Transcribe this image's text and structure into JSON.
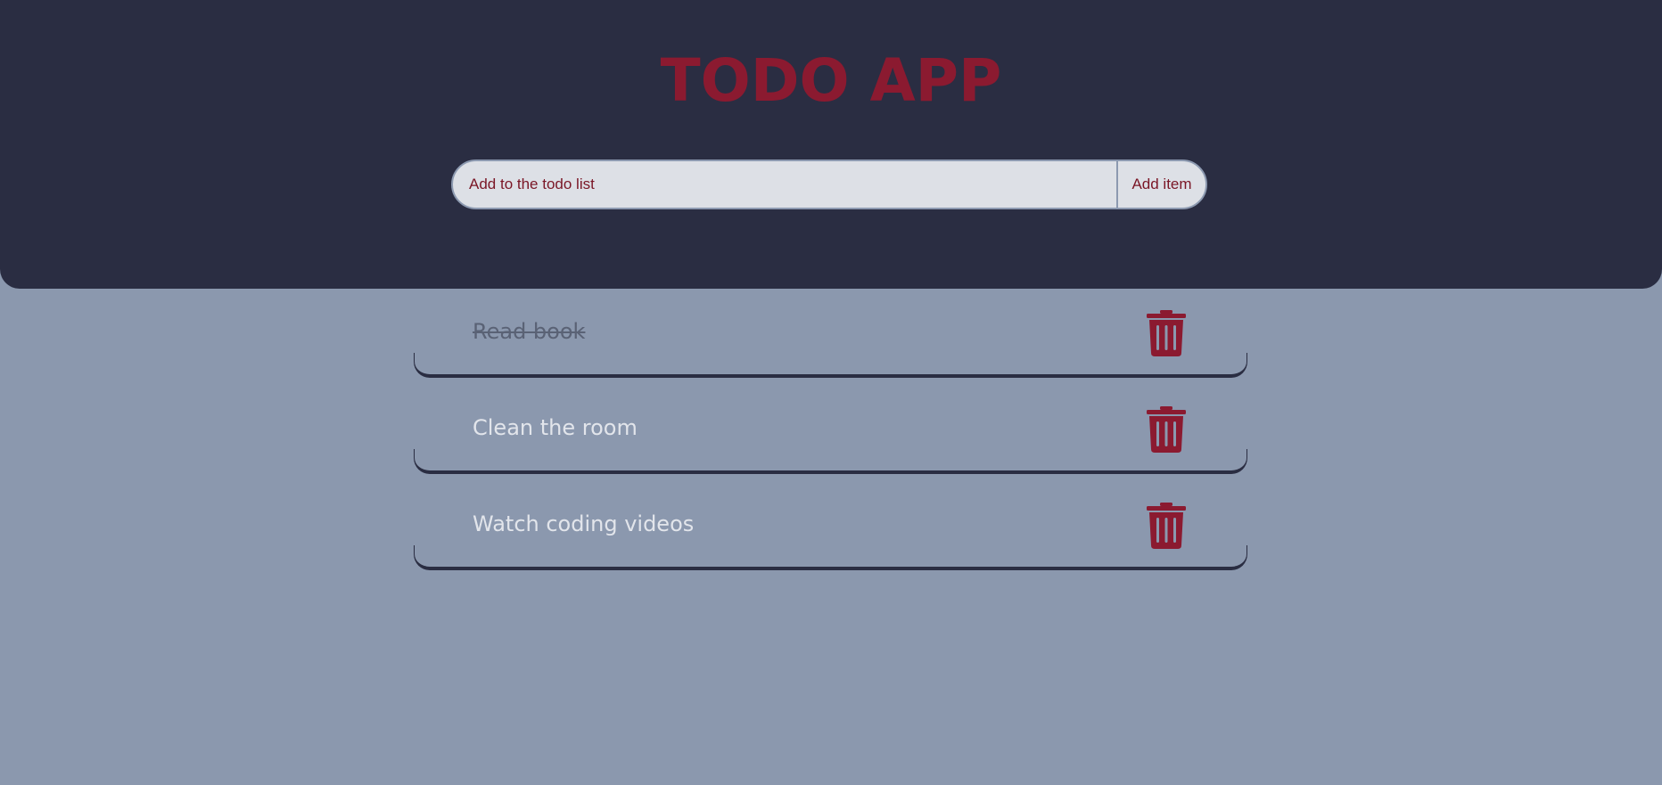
{
  "header": {
    "title": "TODO APP"
  },
  "add_form": {
    "placeholder": "Add to the todo list",
    "button_label": "Add item"
  },
  "todos": [
    {
      "label": "Read book",
      "completed": true
    },
    {
      "label": "Clean the room",
      "completed": false
    },
    {
      "label": "Watch coding videos",
      "completed": false
    }
  ],
  "icons": {
    "delete": "trash-icon"
  },
  "colors": {
    "header_bg": "#2a2d42",
    "page_bg": "#8b98ae",
    "accent": "#8b1a30",
    "input_bg": "#dde0e6",
    "todo_text": "#e2e5eb",
    "completed_text": "#5a6275"
  }
}
